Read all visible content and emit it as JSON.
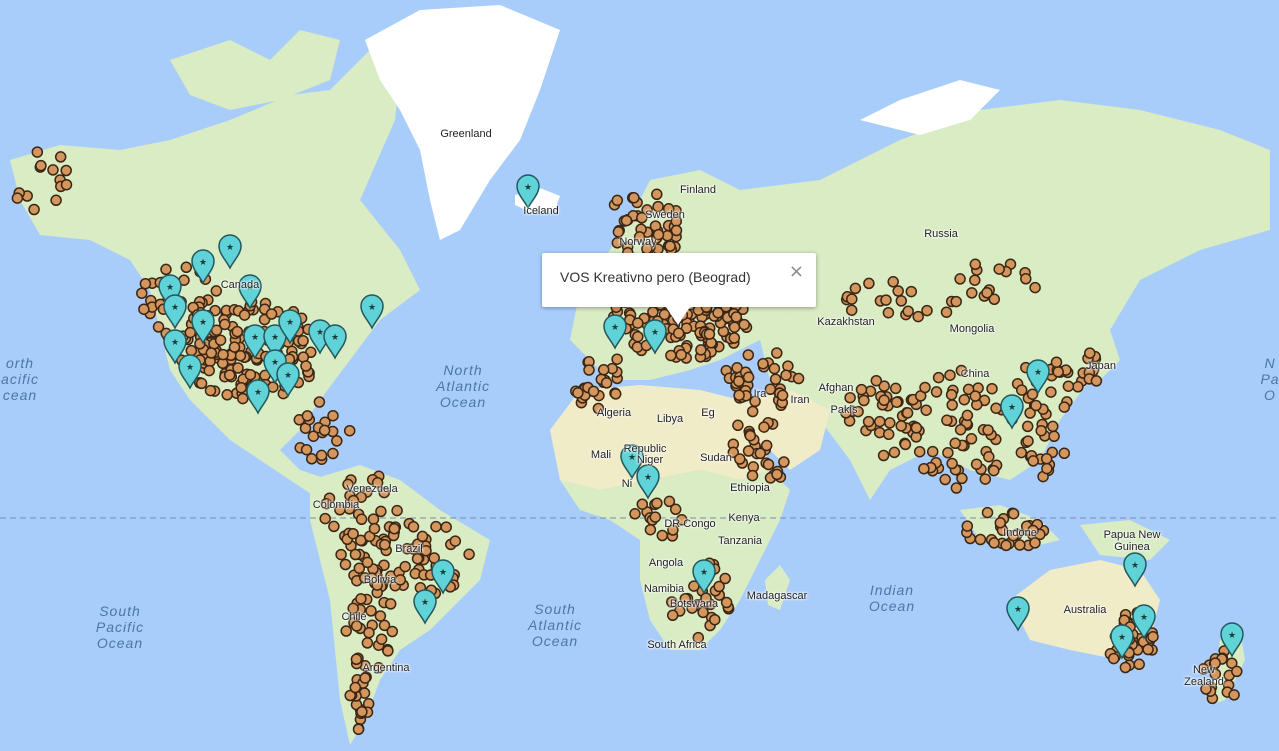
{
  "map": {
    "colors": {
      "water": "#a9cdfb",
      "land": "#d9ecc4",
      "desert": "#f1ecc8",
      "ice": "#ffffff",
      "dot": "#d4965d",
      "dot_stroke": "#3a2614",
      "marker": "#5fd3d8",
      "marker_stroke": "#24585c"
    },
    "countries": [
      {
        "key": "greenland",
        "label": "Greenland"
      },
      {
        "key": "iceland",
        "label": "Iceland"
      },
      {
        "key": "finland",
        "label": "Finland"
      },
      {
        "key": "sweden",
        "label": "Sweden"
      },
      {
        "key": "norway",
        "label": "Norway"
      },
      {
        "key": "russia",
        "label": "Russia"
      },
      {
        "key": "canada",
        "label": "Canada"
      },
      {
        "key": "kazakhstan",
        "label": "Kazakhstan"
      },
      {
        "key": "mongolia",
        "label": "Mongolia"
      },
      {
        "key": "china",
        "label": "China"
      },
      {
        "key": "japan",
        "label": "Japan"
      },
      {
        "key": "afghanistan",
        "label": "Afghan"
      },
      {
        "key": "iran",
        "label": "Iran"
      },
      {
        "key": "iraq",
        "label": "Ira"
      },
      {
        "key": "pakistan",
        "label": "Pakis"
      },
      {
        "key": "algeria",
        "label": "Algeria"
      },
      {
        "key": "libya",
        "label": "Libya"
      },
      {
        "key": "egypt",
        "label": "Eg"
      },
      {
        "key": "mali",
        "label": "Mali"
      },
      {
        "key": "niger",
        "label": "Niger"
      },
      {
        "key": "car",
        "label": "Republic"
      },
      {
        "key": "sudan",
        "label": "Sudan"
      },
      {
        "key": "nigeria",
        "label": "Ni"
      },
      {
        "key": "ethiopia",
        "label": "Ethiopia"
      },
      {
        "key": "drc",
        "label": "DR Congo"
      },
      {
        "key": "kenya",
        "label": "Kenya"
      },
      {
        "key": "tanzania",
        "label": "Tanzania"
      },
      {
        "key": "angola",
        "label": "Angola"
      },
      {
        "key": "namibia",
        "label": "Namibia"
      },
      {
        "key": "botswana",
        "label": "Botswana"
      },
      {
        "key": "madagascar",
        "label": "Madagascar"
      },
      {
        "key": "south_africa",
        "label": "South Africa"
      },
      {
        "key": "venezuela",
        "label": "Venezuela"
      },
      {
        "key": "colombia",
        "label": "Colombia"
      },
      {
        "key": "brazil",
        "label": "Brazil"
      },
      {
        "key": "bolivia",
        "label": "Bolivia"
      },
      {
        "key": "chile",
        "label": "Chile"
      },
      {
        "key": "argentina",
        "label": "Argentina"
      },
      {
        "key": "indonesia",
        "label": "Indone"
      },
      {
        "key": "png",
        "label": "Papua New\nGuinea"
      },
      {
        "key": "australia",
        "label": "Australia"
      },
      {
        "key": "new_zealand",
        "label": "New\nZealand"
      }
    ],
    "oceans": [
      {
        "key": "north_atlantic",
        "label": "North\nAtlantic\nOcean"
      },
      {
        "key": "south_atlantic",
        "label": "South\nAtlantic\nOcean"
      },
      {
        "key": "south_pacific",
        "label": "South\nPacific\nOcean"
      },
      {
        "key": "north_pacific_left",
        "label": "orth\nacific\ncean"
      },
      {
        "key": "north_pacific_right",
        "label": "N\nPa\nO"
      },
      {
        "key": "indian",
        "label": "Indian\nOcean"
      }
    ]
  },
  "popup": {
    "title": "VOS Kreativno pero (Beograd)",
    "close_label": "×"
  }
}
